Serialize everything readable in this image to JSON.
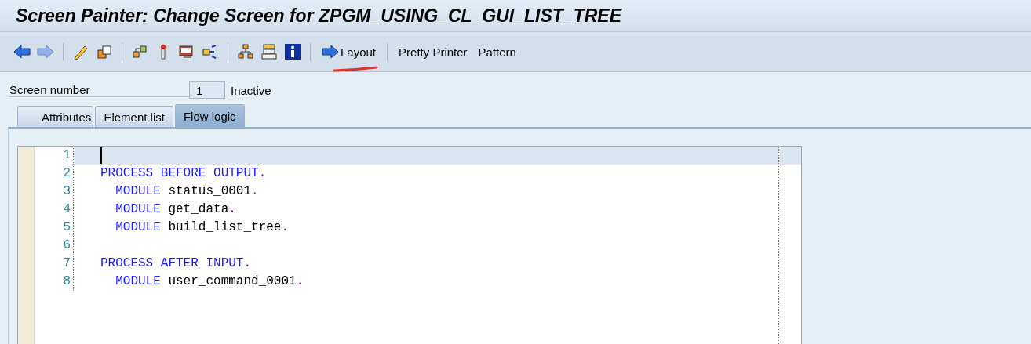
{
  "window": {
    "title": "Screen Painter: Change Screen for ZPGM_USING_CL_GUI_LIST_TREE"
  },
  "toolbar": {
    "text_buttons": [
      "Layout",
      "Pretty Printer",
      "Pattern"
    ]
  },
  "screen_number": {
    "label": "Screen number",
    "value": "1",
    "status": "Inactive"
  },
  "tabs": [
    {
      "label": "Attributes",
      "selected": false
    },
    {
      "label": "Element list",
      "selected": false
    },
    {
      "label": "Flow logic",
      "selected": true
    }
  ],
  "editor": {
    "lines": [
      {
        "number": "1",
        "current": true
      },
      {
        "number": "2",
        "current": false,
        "tokens": [
          {
            "kind": "keyword",
            "text": "PROCESS BEFORE OUTPUT"
          },
          {
            "kind": "period",
            "text": "."
          }
        ]
      },
      {
        "number": "3",
        "current": false,
        "tokens": [
          {
            "kind": "keyword",
            "text": "  MODULE"
          },
          {
            "kind": "ident",
            "text": " status_0001"
          },
          {
            "kind": "period",
            "text": "."
          }
        ]
      },
      {
        "number": "4",
        "current": false,
        "tokens": [
          {
            "kind": "keyword",
            "text": "  MODULE"
          },
          {
            "kind": "ident",
            "text": " get_data"
          },
          {
            "kind": "period",
            "text": "."
          }
        ]
      },
      {
        "number": "5",
        "current": false,
        "tokens": [
          {
            "kind": "keyword",
            "text": "  MODULE"
          },
          {
            "kind": "ident",
            "text": " build_list_tree"
          },
          {
            "kind": "period",
            "text": "."
          }
        ]
      },
      {
        "number": "6",
        "current": false
      },
      {
        "number": "7",
        "current": false,
        "tokens": [
          {
            "kind": "keyword",
            "text": "PROCESS AFTER INPUT"
          },
          {
            "kind": "period",
            "text": "."
          }
        ]
      },
      {
        "number": "8",
        "current": false,
        "tokens": [
          {
            "kind": "keyword",
            "text": "  MODULE"
          },
          {
            "kind": "ident",
            "text": " user_command_0001"
          },
          {
            "kind": "period",
            "text": "."
          }
        ]
      }
    ]
  }
}
